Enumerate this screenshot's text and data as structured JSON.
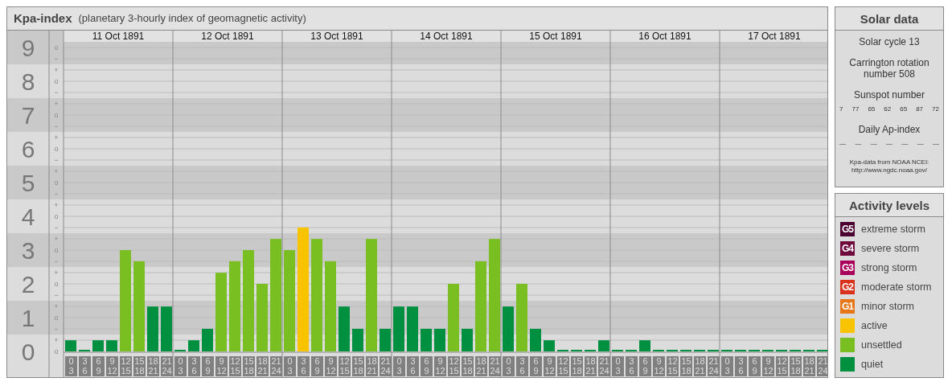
{
  "kp_chart": {
    "title": "Kpa-index",
    "subtitle": "(planetary 3-hourly index of geomagnetic activity)",
    "days": [
      "11 Oct 1891",
      "12 Oct 1891",
      "13 Oct 1891",
      "14 Oct 1891",
      "15 Oct 1891",
      "16 Oct 1891",
      "17 Oct 1891"
    ],
    "sub_tick_labels": [
      "o",
      "−",
      "+",
      "o",
      "−",
      "+",
      "o",
      "−",
      "+",
      "o",
      "−",
      "+",
      "o",
      "−",
      "+",
      "o",
      "−",
      "+",
      "o",
      "−",
      "+",
      "o",
      "−",
      "+",
      "o",
      "−",
      "+",
      "o"
    ],
    "chart_data": {
      "type": "bar",
      "ylim": [
        0,
        9.5
      ],
      "grid": true,
      "yticks": [
        {
          "value": 9,
          "label": "9"
        },
        {
          "value": 8,
          "label": "8"
        },
        {
          "value": 7,
          "label": "7"
        },
        {
          "value": 6,
          "label": "6"
        },
        {
          "value": 5,
          "label": "5"
        },
        {
          "value": 4,
          "label": "4"
        },
        {
          "value": 3,
          "label": "3"
        },
        {
          "value": 2,
          "label": "2"
        },
        {
          "value": 1,
          "label": "1"
        },
        {
          "value": 0,
          "label": "0"
        }
      ],
      "categories": [
        "0 3",
        "3 6",
        "6 9",
        "9 12",
        "12 15",
        "15 18",
        "18 21",
        "21 24",
        "0 3",
        "3 6",
        "6 9",
        "9 12",
        "12 15",
        "15 18",
        "18 21",
        "21 24",
        "0 3",
        "3 6",
        "6 9",
        "9 12",
        "12 15",
        "15 18",
        "18 21",
        "21 24",
        "0 3",
        "3 6",
        "6 9",
        "9 12",
        "12 15",
        "15 18",
        "18 21",
        "21 24",
        "0 3",
        "3 6",
        "6 9",
        "9 12",
        "12 15",
        "15 18",
        "18 21",
        "21 24",
        "0 3",
        "3 6",
        "6 9",
        "9 12",
        "12 15",
        "15 18",
        "18 21",
        "21 24",
        "0 3",
        "3 6",
        "6 9",
        "9 12",
        "12 15",
        "15 18",
        "18 21",
        "21 24"
      ],
      "series": [
        {
          "values": [
            0.33,
            0,
            0.33,
            0.33,
            3,
            2.67,
            1.33,
            1.33,
            0,
            0.33,
            0.67,
            2.33,
            2.67,
            3,
            2,
            3.33,
            3,
            3.67,
            3.33,
            2.67,
            1.33,
            0.67,
            3.33,
            0.67,
            1.33,
            1.33,
            0.67,
            0.67,
            2,
            0.67,
            2.67,
            3.33,
            1.33,
            2,
            0.67,
            0.33,
            0,
            0,
            0,
            0.33,
            0,
            0,
            0.33,
            0,
            0,
            0,
            0,
            0,
            0,
            0,
            0,
            0,
            0,
            0,
            0,
            0
          ]
        }
      ]
    }
  },
  "solar_data": {
    "title": "Solar data",
    "solar_cycle": "Solar cycle 13",
    "carrington_rotation": "Carrington rotation number 508",
    "sunspot_heading": "Sunspot number",
    "sunspot_numbers": [
      "7",
      "77",
      "65",
      "62",
      "65",
      "87",
      "72"
    ],
    "ap_heading": "Daily Ap-index",
    "ap_values": [
      "—",
      "—",
      "—",
      "—",
      "—",
      "—",
      "—"
    ],
    "source_note": "Kpa-data from NOAA NCEI: http://www.ngdc.noaa.gov/"
  },
  "activity_levels": {
    "title": "Activity levels",
    "items": [
      {
        "badge": "G5",
        "label": "extreme storm",
        "color": "#4b0030"
      },
      {
        "badge": "G4",
        "label": "severe storm",
        "color": "#6e0b3c"
      },
      {
        "badge": "G3",
        "label": "strong storm",
        "color": "#a9005c"
      },
      {
        "badge": "G2",
        "label": "moderate storm",
        "color": "#d8321d"
      },
      {
        "badge": "G1",
        "label": "minor storm",
        "color": "#e67718"
      },
      {
        "label": "active",
        "color": "#f8c300"
      },
      {
        "label": "unsettled",
        "color": "#79bf21"
      },
      {
        "label": "quiet",
        "color": "#00903f"
      }
    ]
  }
}
